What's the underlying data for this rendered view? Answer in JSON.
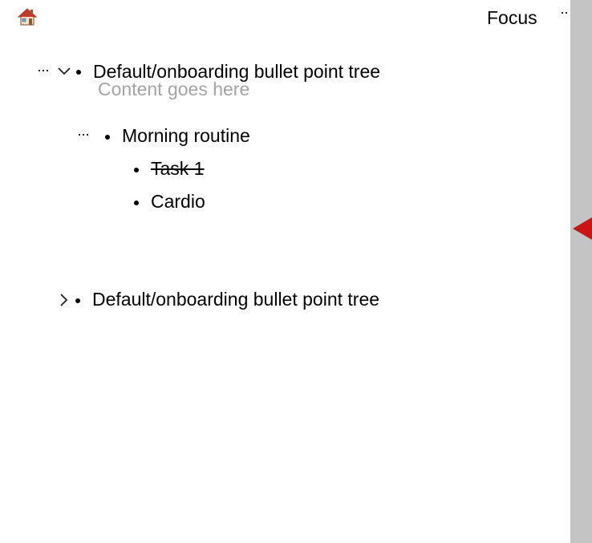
{
  "header": {
    "home_icon": "house-emoji-icon",
    "focus_label": "Focus",
    "more_label": "··"
  },
  "tree": {
    "root1": {
      "more_label": "···",
      "expanded": true,
      "title": "Default/onboarding bullet point tree",
      "content_placeholder": "Content goes here"
    },
    "child": {
      "more_label": "···",
      "title": "Morning routine",
      "items": [
        {
          "label": "Task 1",
          "done": true
        },
        {
          "label": "Cardio",
          "done": false
        }
      ]
    },
    "root2": {
      "expanded": false,
      "title": "Default/onboarding bullet point tree"
    }
  },
  "scrollbar": {
    "marker_color": "#cc1414",
    "track_color": "#c4c4c4"
  }
}
